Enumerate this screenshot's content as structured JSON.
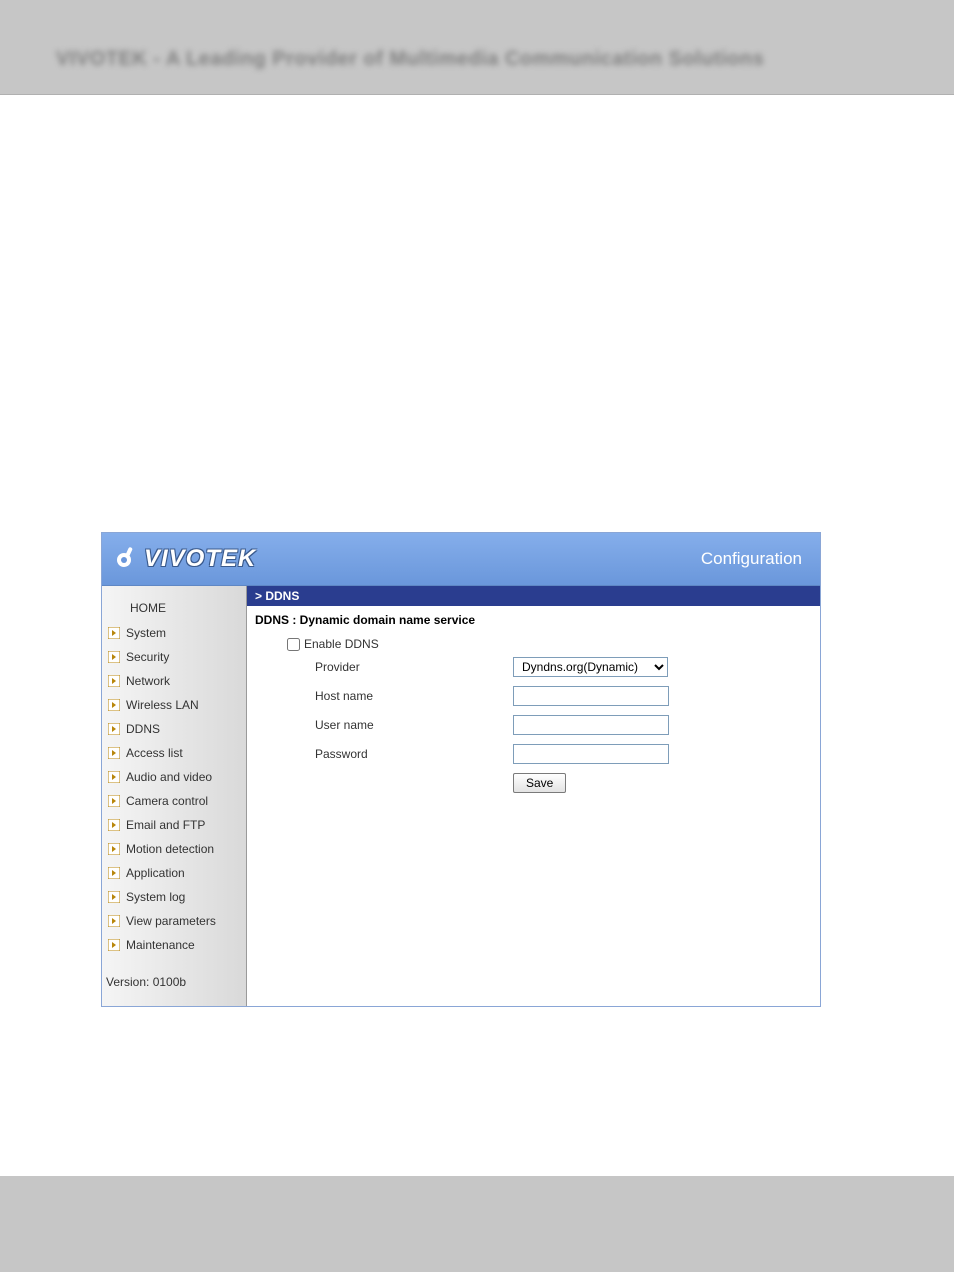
{
  "topbar": {
    "blur_text": "VIVOTEK - A Leading Provider of Multimedia Communication Solutions"
  },
  "header": {
    "logo_text": "VIVOTEK",
    "title": "Configuration"
  },
  "sidebar": {
    "home": "HOME",
    "items": [
      {
        "label": "System"
      },
      {
        "label": "Security"
      },
      {
        "label": "Network"
      },
      {
        "label": "Wireless LAN"
      },
      {
        "label": "DDNS"
      },
      {
        "label": "Access list"
      },
      {
        "label": "Audio and video"
      },
      {
        "label": "Camera control"
      },
      {
        "label": "Email and FTP"
      },
      {
        "label": "Motion detection"
      },
      {
        "label": "Application"
      },
      {
        "label": "System log"
      },
      {
        "label": "View parameters"
      },
      {
        "label": "Maintenance"
      }
    ],
    "version": "Version: 0100b"
  },
  "breadcrumb": "> DDNS",
  "panel": {
    "title": "DDNS : Dynamic domain name service",
    "enable_label": "Enable DDNS",
    "enable_checked": false,
    "provider_label": "Provider",
    "provider_value": "Dyndns.org(Dynamic)",
    "hostname_label": "Host name",
    "hostname_value": "",
    "username_label": "User name",
    "username_value": "",
    "password_label": "Password",
    "password_value": "",
    "save_label": "Save"
  }
}
